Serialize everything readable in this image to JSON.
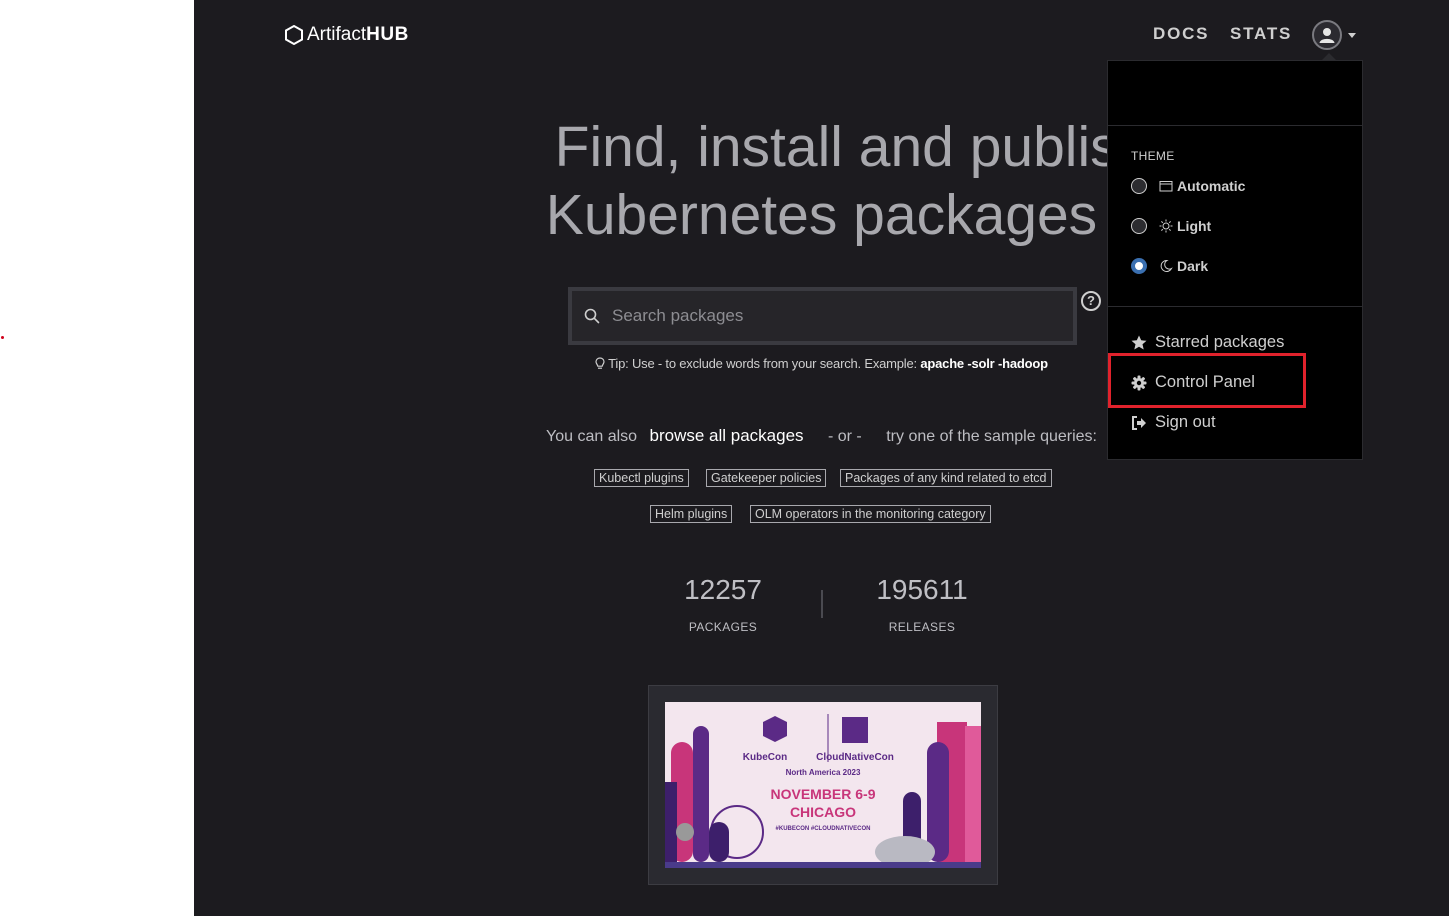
{
  "navbar": {
    "logo_part1": "Artifact",
    "logo_part2": "HUB",
    "links": [
      "DOCS",
      "STATS"
    ],
    "user_icon": "user-circle-icon"
  },
  "hero": {
    "line1": "Find, install and publish",
    "line2": "Kubernetes packages"
  },
  "search": {
    "placeholder": "Search packages",
    "tip_prefix": "Tip: Use - to exclude words from your search. Example:",
    "tip_example": "apache -solr -hadoop"
  },
  "browse": {
    "prefix": "You can also",
    "link": "browse all packages",
    "or": "- or -",
    "suffix": "try one of the sample queries:"
  },
  "sample_queries": [
    "Kubectl plugins",
    "Gatekeeper policies",
    "Packages of any kind related to etcd",
    "Helm plugins",
    "OLM operators in the monitoring category"
  ],
  "stats": {
    "packages_value": "12257",
    "packages_label": "PACKAGES",
    "releases_value": "195611",
    "releases_label": "RELEASES"
  },
  "banner": {
    "brand1": "KubeCon",
    "brand2": "CloudNativeCon",
    "region": "North America 2023",
    "dates": "NOVEMBER 6-9",
    "city": "CHICAGO",
    "hashtags": "#KUBECON #CLOUDNATIVECON"
  },
  "user_menu": {
    "theme_title": "THEME",
    "themes": [
      {
        "label": "Automatic",
        "icon": "calendar-icon",
        "selected": false
      },
      {
        "label": "Light",
        "icon": "sun-icon",
        "selected": false
      },
      {
        "label": "Dark",
        "icon": "moon-icon",
        "selected": true
      }
    ],
    "items": [
      {
        "label": "Starred packages",
        "icon": "star-icon"
      },
      {
        "label": "Control Panel",
        "icon": "gear-icon"
      },
      {
        "label": "Sign out",
        "icon": "sign-out-icon"
      }
    ]
  },
  "colors": {
    "background": "#1c1b1f",
    "dropdown": "#000000",
    "highlight": "#e0222c",
    "radio_selected": "#3a6fb0"
  }
}
